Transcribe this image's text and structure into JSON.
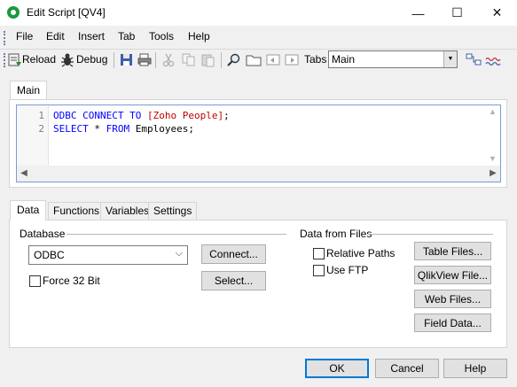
{
  "window": {
    "title": "Edit Script [QV4]",
    "min_glyph": "—",
    "max_glyph": "☐",
    "close_glyph": "✕"
  },
  "menu": [
    "File",
    "Edit",
    "Insert",
    "Tab",
    "Tools",
    "Help"
  ],
  "toolbar": {
    "reload_label": "Reload",
    "debug_label": "Debug",
    "tabs_label": "Tabs",
    "tabs_selected": "Main"
  },
  "editor": {
    "tab_label": "Main",
    "line_numbers": [
      "1",
      "2"
    ],
    "lines": [
      [
        {
          "t": "ODBC ",
          "c": "kw"
        },
        {
          "t": "CONNECT",
          "c": "kw"
        },
        {
          "t": " ",
          "c": ""
        },
        {
          "t": "TO",
          "c": "kw"
        },
        {
          "t": " ",
          "c": ""
        },
        {
          "t": "[Zoho People]",
          "c": "str"
        },
        {
          "t": ";",
          "c": ""
        }
      ],
      [
        {
          "t": "SELECT",
          "c": "kw"
        },
        {
          "t": " * ",
          "c": ""
        },
        {
          "t": "FROM",
          "c": "kw"
        },
        {
          "t": " Employees;",
          "c": ""
        }
      ]
    ]
  },
  "bottom_tabs": [
    "Data",
    "Functions",
    "Variables",
    "Settings"
  ],
  "database": {
    "section_label": "Database",
    "selected": "ODBC",
    "connect_label": "Connect...",
    "select_label": "Select...",
    "force32_label": "Force 32 Bit",
    "force32_checked": false
  },
  "files": {
    "section_label": "Data from Files",
    "relative_paths_label": "Relative Paths",
    "relative_paths_checked": false,
    "use_ftp_label": "Use FTP",
    "use_ftp_checked": false,
    "buttons": [
      "Table Files...",
      "QlikView File...",
      "Web Files...",
      "Field Data..."
    ]
  },
  "dialog_buttons": {
    "ok": "OK",
    "cancel": "Cancel",
    "help": "Help"
  },
  "colors": {
    "keyword": "#0000ff",
    "string": "#c00000",
    "focus_border": "#0078d7"
  }
}
